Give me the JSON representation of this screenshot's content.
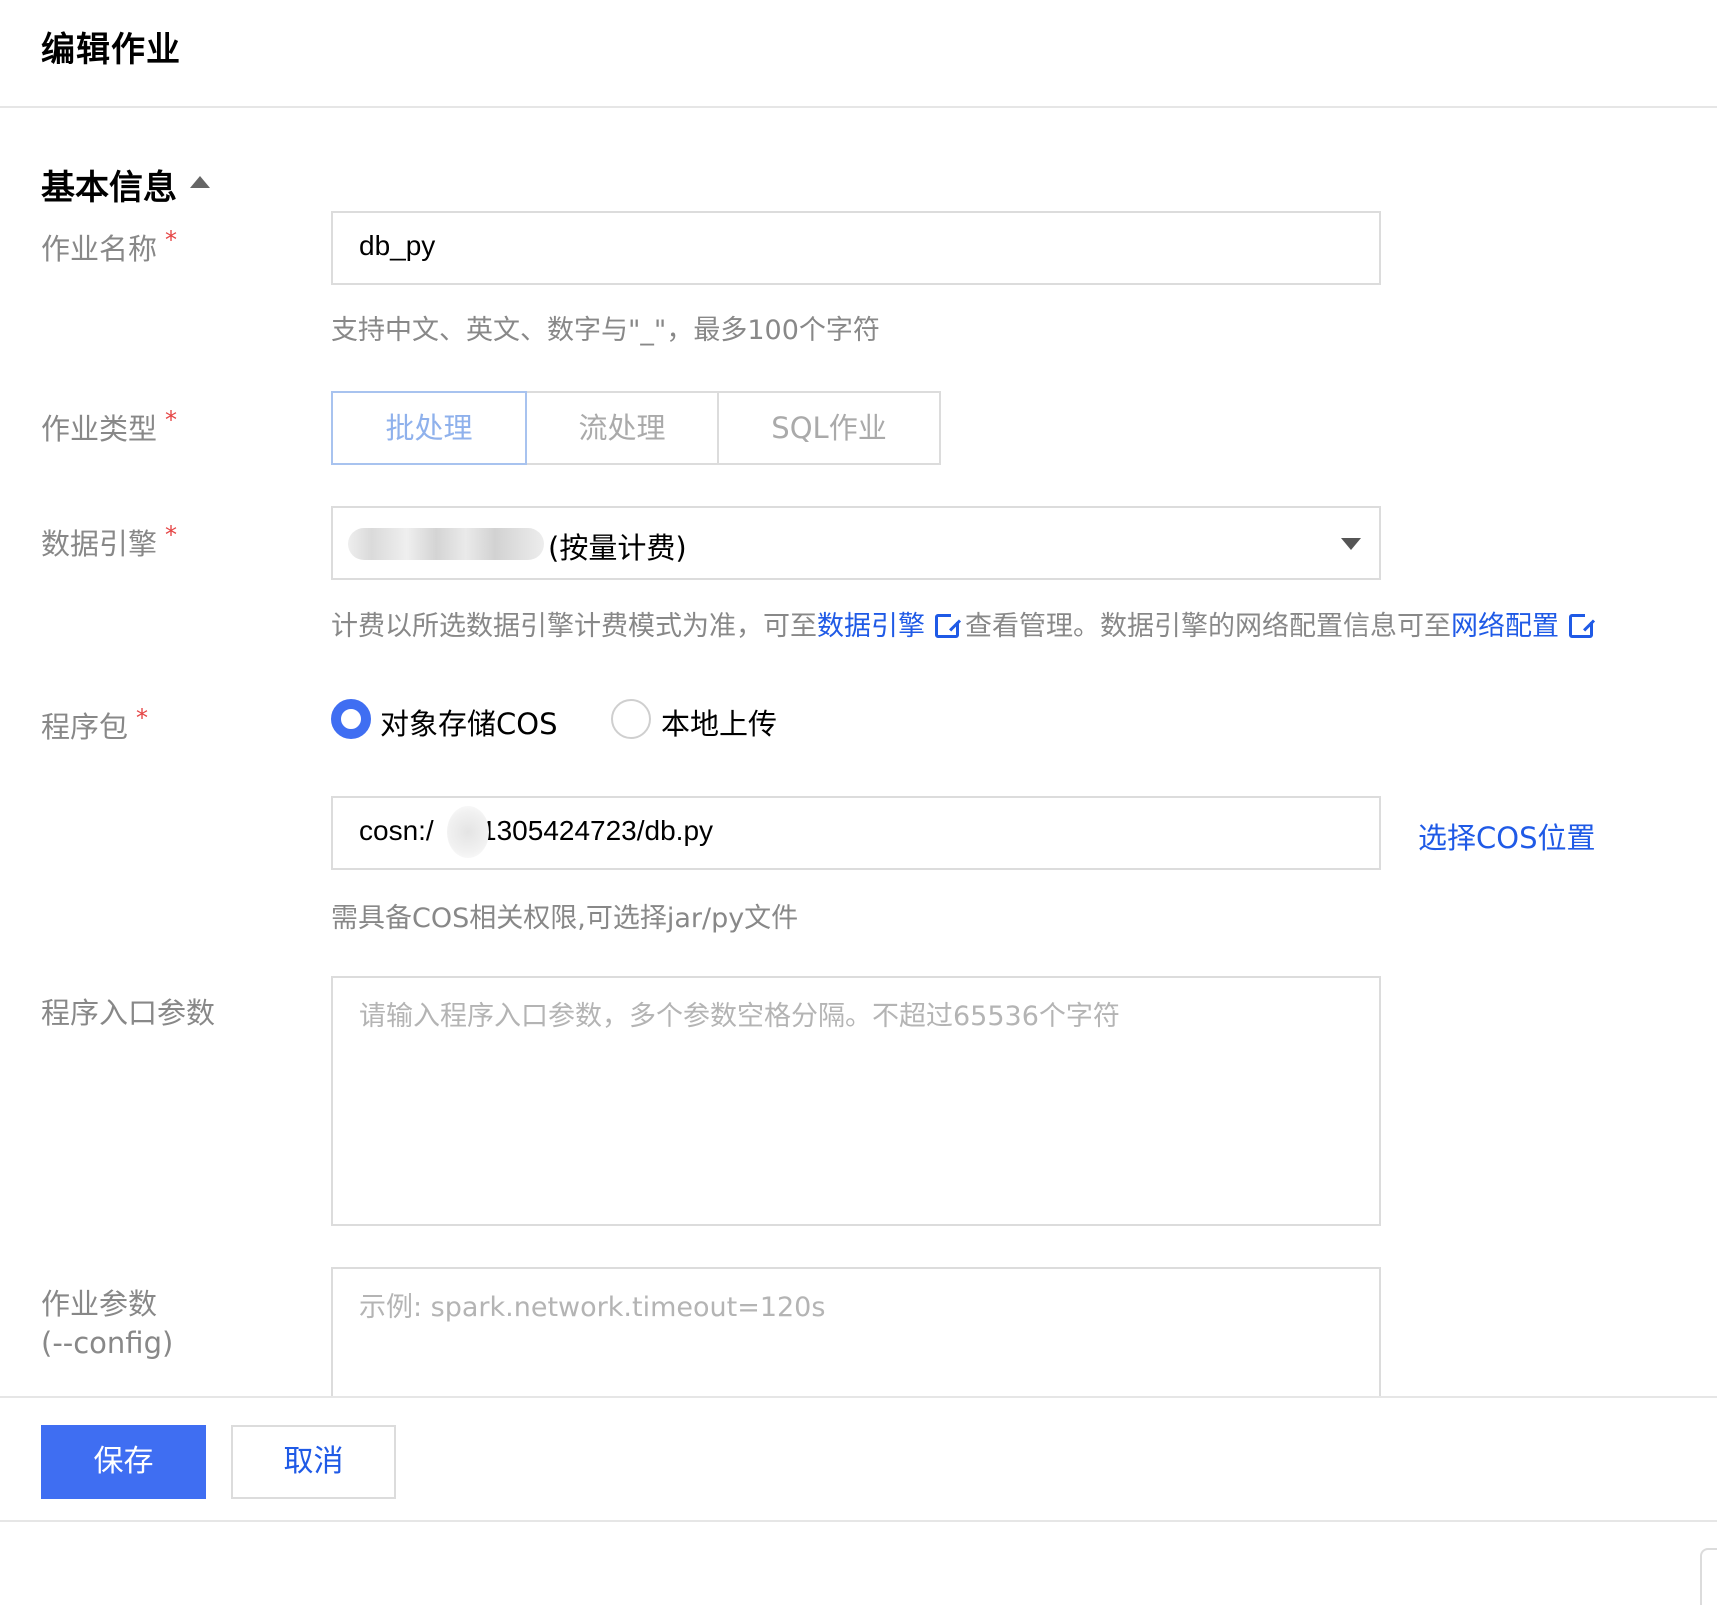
{
  "header": {
    "title": "编辑作业"
  },
  "basic_info": {
    "title": "基本信息",
    "job_name": {
      "label": "作业名称",
      "required": "*",
      "value": "db_py",
      "hint": "支持中文、英文、数字与\"_\"，最多100个字符"
    },
    "job_type": {
      "label": "作业类型",
      "required": "*",
      "options": [
        "批处理",
        "流处理",
        "SQL作业"
      ],
      "selected": "批处理"
    },
    "data_engine": {
      "label": "数据引擎",
      "required": "*",
      "value_suffix": "(按量计费)",
      "hint_part1": "计费以所选数据引擎计费模式为准，可至",
      "hint_link1": "数据引擎",
      "hint_part2": "查看管理。数据引擎的网络配置信息可至",
      "hint_link2": "网络配置"
    },
    "package": {
      "label": "程序包",
      "required": "*",
      "option_cos": "对象存储COS",
      "option_local": "本地上传",
      "selected": "对象存储COS",
      "cos_prefix": "cosn:/",
      "cos_suffix": "-1305424723/db.py",
      "choose_cos": "选择COS位置",
      "hint": "需具备COS相关权限,可选择jar/py文件"
    },
    "entry_params": {
      "label": "程序入口参数",
      "placeholder": "请输入程序入口参数，多个参数空格分隔。不超过65536个字符"
    },
    "job_params": {
      "label_line1": "作业参数",
      "label_line2": "(--config)",
      "placeholder": "示例: spark.network.timeout=120s"
    }
  },
  "footer": {
    "save_label": "保存",
    "cancel_label": "取消"
  },
  "colors": {
    "primary": "#3f6ef2",
    "link": "#1f5ae6",
    "required": "#e54545",
    "border": "#dcdcdc"
  },
  "icons": {
    "caret": "caret-up-icon",
    "dropdown": "chevron-down-icon",
    "external": "external-link-icon"
  }
}
